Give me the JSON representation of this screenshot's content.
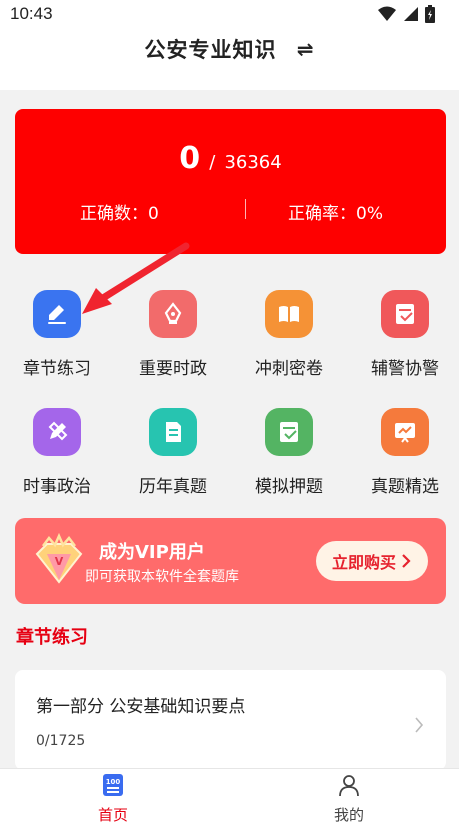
{
  "status_bar": {
    "time": "10:43",
    "icons": [
      "wifi-icon",
      "signal-icon",
      "battery-icon"
    ]
  },
  "header": {
    "title": "公安专业知识",
    "switch_icon": "swap-icon"
  },
  "score": {
    "answered": "0",
    "separator": "/",
    "total": "36364",
    "correct_label": "正确数：0",
    "rate_label": "正确率：0%"
  },
  "menu": [
    {
      "label": "章节练习",
      "icon": "edit-icon",
      "color": "#3a74f0"
    },
    {
      "label": "重要时政",
      "icon": "pen-icon",
      "color": "#f26b6b"
    },
    {
      "label": "冲刺密卷",
      "icon": "book-icon",
      "color": "#f59236"
    },
    {
      "label": "辅警协警",
      "icon": "score-100-icon",
      "color": "#f0585a"
    },
    {
      "label": "时事政治",
      "icon": "pencil-icon",
      "color": "#a466ea"
    },
    {
      "label": "历年真题",
      "icon": "document-icon",
      "color": "#27c4b0"
    },
    {
      "label": "模拟押题",
      "icon": "score-100-icon",
      "color": "#54b463"
    },
    {
      "label": "真题精选",
      "icon": "chart-board-icon",
      "color": "#f57a3c"
    }
  ],
  "vip": {
    "title": "成为VIP用户",
    "subtitle": "即可获取本软件全套题库",
    "button": "立即购买"
  },
  "section": {
    "title": "章节练习"
  },
  "chapters": [
    {
      "title": "第一部分 公安基础知识要点",
      "progress": "0/1725"
    }
  ],
  "tabs": [
    {
      "label": "首页",
      "icon": "home-100-icon",
      "active": true
    },
    {
      "label": "我的",
      "icon": "user-icon",
      "active": false
    }
  ],
  "colors": {
    "primary": "#e60012",
    "score_bg": "#fe0000",
    "vip_bg": "#ff6b6b"
  }
}
